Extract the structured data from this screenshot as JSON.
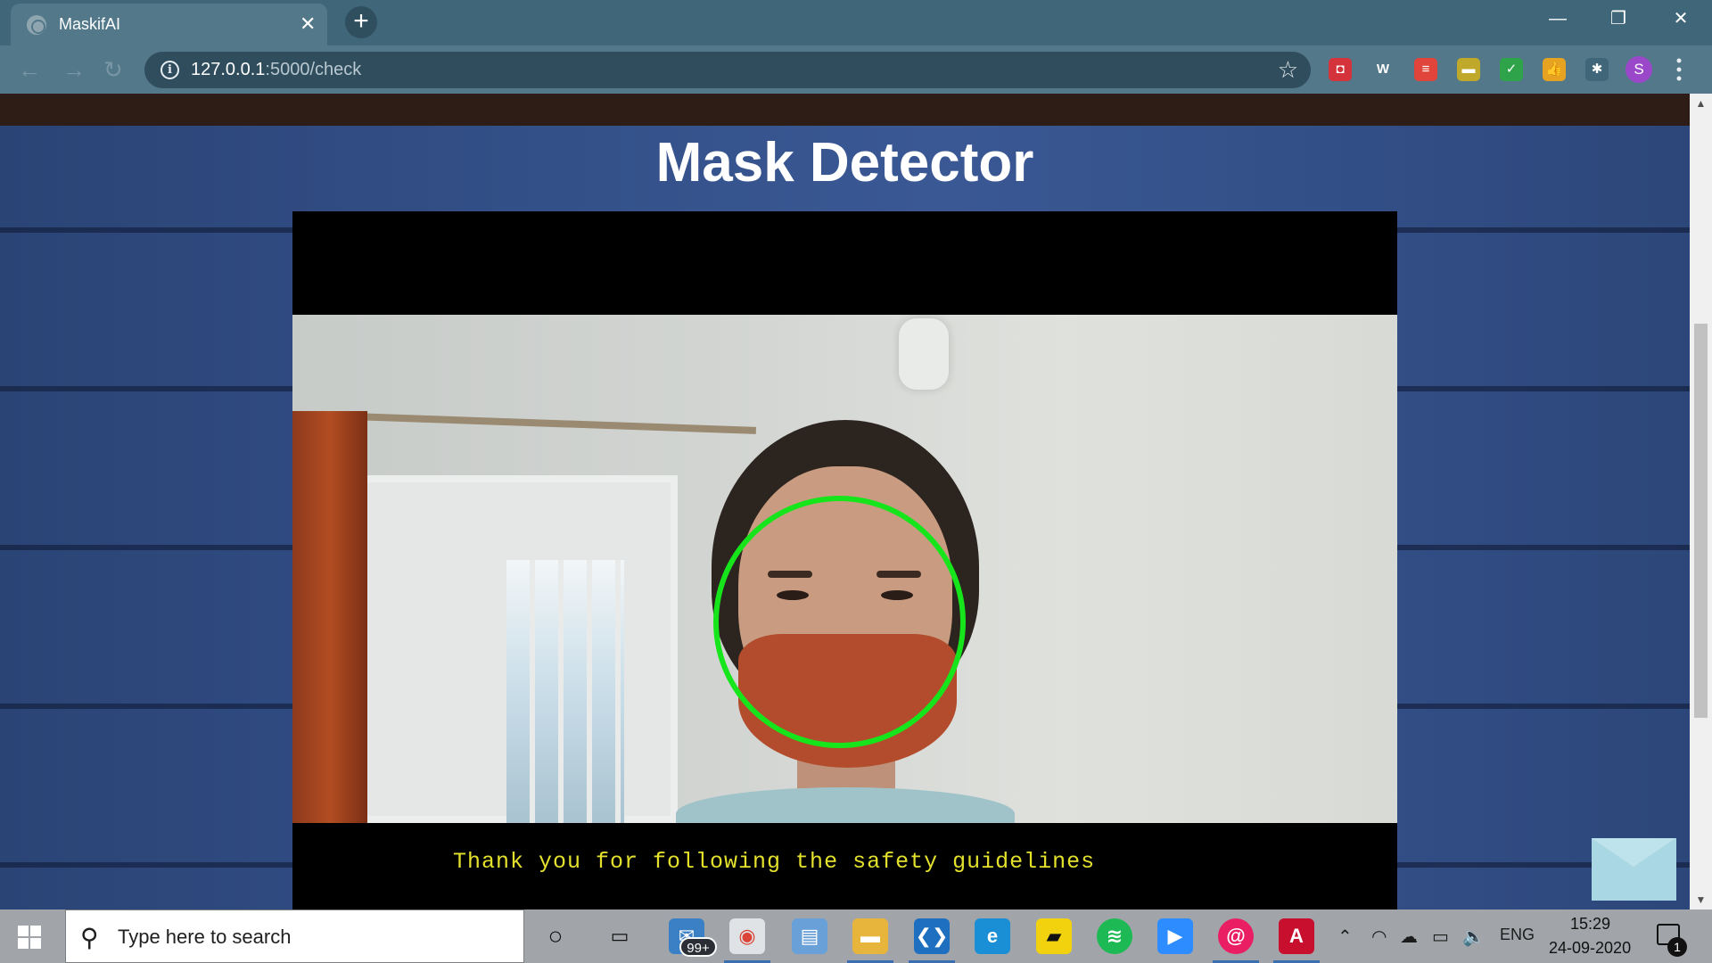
{
  "browser": {
    "tab_title": "MaskifAI",
    "tab_close": "✕",
    "new_tab": "+",
    "window_controls": {
      "minimize": "—",
      "restore": "❐",
      "close": "✕"
    },
    "url_host": "127.0.0.1",
    "url_path": ":5000/check",
    "extensions": [
      {
        "name": "pocket-extension-icon",
        "glyph": "◘",
        "color": "#d5333b"
      },
      {
        "name": "w-extension-icon",
        "glyph": "W",
        "color": "#52788a"
      },
      {
        "name": "todoist-extension-icon",
        "glyph": "≡",
        "color": "#e1443a"
      },
      {
        "name": "notes-extension-icon",
        "glyph": "▬",
        "color": "#bfa82a"
      },
      {
        "name": "shield-extension-icon",
        "glyph": "✓",
        "color": "#2fa34a"
      },
      {
        "name": "thumbs-up-extension-icon",
        "glyph": "👍",
        "color": "#e5a321"
      },
      {
        "name": "puzzle-extension-icon",
        "glyph": "✱",
        "color": "#3f6679"
      }
    ],
    "profile_initial": "S"
  },
  "page": {
    "title": "Mask Detector",
    "video_caption": "Thank you for following the safety guidelines"
  },
  "taskbar": {
    "search_placeholder": "Type here to search",
    "mail_badge": "99+",
    "language": "ENG",
    "time": "15:29",
    "date": "24-09-2020",
    "notification_count": "1"
  },
  "colors": {
    "detection_ring": "#17e51b",
    "caption_text": "#e4e12c",
    "page_navbar": "#2e1c16"
  }
}
